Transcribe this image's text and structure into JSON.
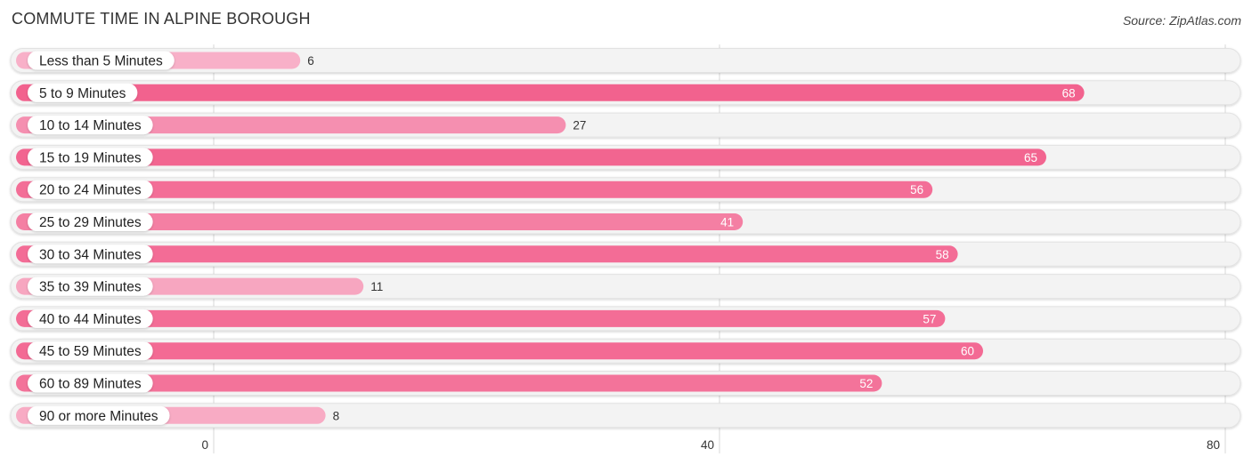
{
  "header": {
    "title": "COMMUTE TIME IN ALPINE BOROUGH",
    "source": "Source: ZipAtlas.com"
  },
  "colors": {
    "bar_low": "#f8b0c8",
    "bar_high": "#f2628e",
    "track": "#f3f3f3",
    "gridline": "#d8d8d8",
    "label_bg": "#ffffff",
    "value_inside": "#ffffff",
    "value_outside": "#333333"
  },
  "chart_data": {
    "type": "bar",
    "orientation": "horizontal",
    "title": "COMMUTE TIME IN ALPINE BOROUGH",
    "xlabel": "",
    "ylabel": "",
    "categories": [
      "Less than 5 Minutes",
      "5 to 9 Minutes",
      "10 to 14 Minutes",
      "15 to 19 Minutes",
      "20 to 24 Minutes",
      "25 to 29 Minutes",
      "30 to 34 Minutes",
      "35 to 39 Minutes",
      "40 to 44 Minutes",
      "45 to 59 Minutes",
      "60 to 89 Minutes",
      "90 or more Minutes"
    ],
    "values": [
      6,
      68,
      27,
      65,
      56,
      41,
      58,
      11,
      57,
      60,
      52,
      8
    ],
    "xlim": [
      0,
      80
    ],
    "xticks": [
      0,
      40,
      80
    ],
    "grid": true,
    "legend": "none"
  }
}
